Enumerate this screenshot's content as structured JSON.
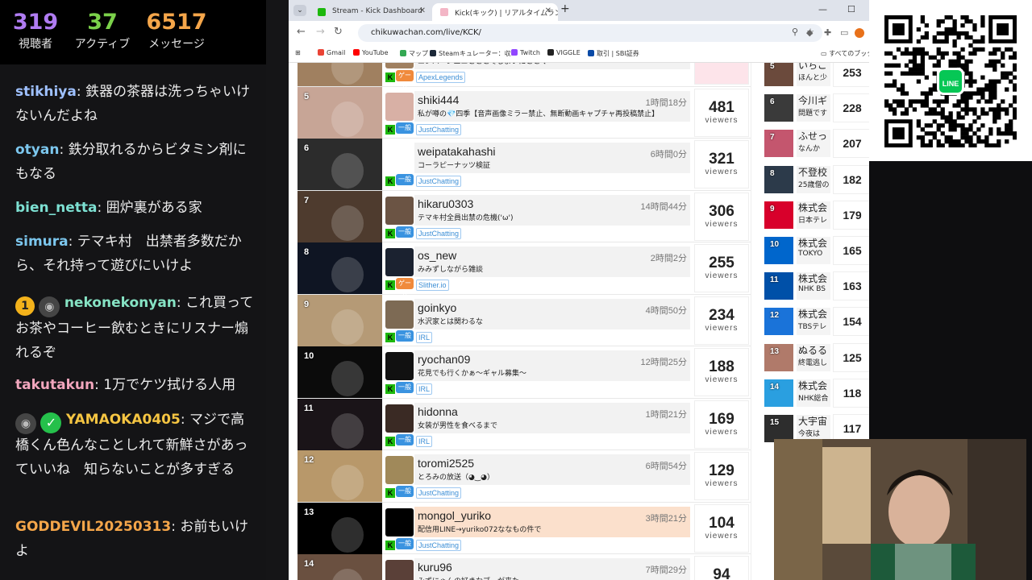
{
  "stats": [
    {
      "value": "319",
      "label": "視聴者",
      "color": "#b07cf2"
    },
    {
      "value": "37",
      "label": "アクティブ",
      "color": "#7bd14a"
    },
    {
      "value": "6517",
      "label": "メッセージ",
      "color": "#f5a64a"
    }
  ],
  "chat": [
    {
      "user": "stikhiya",
      "user_color": "#9fc1ff",
      "text": "鉄器の茶器は洗っちゃいけないんだよね",
      "badges": []
    },
    {
      "user": "otyan",
      "user_color": "#7cc7ee",
      "text": "鉄分取れるからビタミン剤にもなる",
      "badges": []
    },
    {
      "user": "bien_netta",
      "user_color": "#7de0d2",
      "text": "囲炉裏がある家",
      "badges": []
    },
    {
      "user": "simura",
      "user_color": "#7cc7ee",
      "text": "テマキ村　出禁者多数だから、それ持って遊びにいけよ",
      "badges": []
    },
    {
      "user": "nekonekonyan",
      "user_color": "#86e3c4",
      "text": "これ買ってお茶やコーヒー飲むときにリスナー煽れるぞ",
      "badges": [
        "1",
        "avatar"
      ]
    },
    {
      "user": "takutakun",
      "user_color": "#f2a6bd",
      "text": "1万でケツ拭ける人用",
      "badges": []
    },
    {
      "user": "YAMAOKA0405",
      "user_color": "#f5c542",
      "text": "マジで高橋くん色んなことしれて新鮮さがあっていいね　知らないことが多すぎる",
      "badges": [
        "avatar",
        "check"
      ]
    },
    {
      "user": "GODDEVIL20250313",
      "user_color": "#f5a64a",
      "text": "お前もいけよ",
      "badges": []
    }
  ],
  "browser": {
    "tabs": [
      {
        "label": "Stream - Kick Dashboard",
        "active": false,
        "favicon_color": "#1db80d"
      },
      {
        "label": "Kick(キック) | リアルタイムランキング",
        "active": true,
        "favicon_color": "#f3b6c6"
      }
    ],
    "url": "chikuwachan.com/live/KCK/",
    "bookmarks": [
      {
        "label": "Gmail",
        "color": "#ea4335"
      },
      {
        "label": "YouTube",
        "color": "#ff0000"
      },
      {
        "label": "マップ",
        "color": "#34a853"
      },
      {
        "label": "Steamキュレーター：収...",
        "color": "#1b2838"
      },
      {
        "label": "Twitch",
        "color": "#9146ff"
      },
      {
        "label": "VIGGLE",
        "color": "#222222"
      },
      {
        "label": "取引 | SBI証券",
        "color": "#0a4aa6"
      }
    ],
    "bookmarks_right": "すべてのブック"
  },
  "ranking": [
    {
      "rank": "",
      "name": "",
      "title": "ニンバーンエニとととてしよいにととく",
      "duration": "",
      "category": "ApexLegends",
      "tag": "ゲーム",
      "viewers": "",
      "viewers_label": "viewers",
      "highlight": false,
      "top_cut": true
    },
    {
      "rank": "5",
      "name": "shiki444",
      "title": "私が噂の💎四季【音声画像ミラー禁止、無断動画キャプチャ再投稿禁止】",
      "duration": "1時間18分",
      "category": "JustChatting",
      "tag": "一般",
      "viewers": "481",
      "viewers_label": "viewers",
      "highlight": false
    },
    {
      "rank": "6",
      "name": "weipatakahashi",
      "title": "コーラピーナッツ検証",
      "duration": "6時間0分",
      "category": "JustChatting",
      "tag": "一般",
      "viewers": "321",
      "viewers_label": "viewers",
      "highlight": false
    },
    {
      "rank": "7",
      "name": "hikaru0303",
      "title": "テマキ村全員出禁の危機('ω')",
      "duration": "14時間44分",
      "category": "JustChatting",
      "tag": "一般",
      "viewers": "306",
      "viewers_label": "viewers",
      "highlight": false
    },
    {
      "rank": "8",
      "name": "os_new",
      "title": "みみずしながら雑談",
      "duration": "2時間2分",
      "category": "Slither.io",
      "tag": "ゲーム",
      "viewers": "255",
      "viewers_label": "viewers",
      "highlight": false
    },
    {
      "rank": "9",
      "name": "goinkyo",
      "title": "水沢家とは関わるな",
      "duration": "4時間50分",
      "category": "IRL",
      "tag": "一般",
      "viewers": "234",
      "viewers_label": "viewers",
      "highlight": false
    },
    {
      "rank": "10",
      "name": "ryochan09",
      "title": "花見でも行くかぁ～ギャル募集～",
      "duration": "12時間25分",
      "category": "IRL",
      "tag": "一般",
      "viewers": "188",
      "viewers_label": "viewers",
      "highlight": false
    },
    {
      "rank": "11",
      "name": "hidonna",
      "title": "女装が男性を食べるまで",
      "duration": "1時間21分",
      "category": "IRL",
      "tag": "一般",
      "viewers": "169",
      "viewers_label": "viewers",
      "highlight": false
    },
    {
      "rank": "12",
      "name": "toromi2525",
      "title": "とろみの放送（◕‿◕）",
      "duration": "6時間54分",
      "category": "JustChatting",
      "tag": "一般",
      "viewers": "129",
      "viewers_label": "viewers",
      "highlight": false
    },
    {
      "rank": "13",
      "name": "mongol_yuriko",
      "title": "配信用LINE→yuriko072ななもの件で",
      "duration": "3時間21分",
      "category": "JustChatting",
      "tag": "一般",
      "viewers": "104",
      "viewers_label": "viewers",
      "highlight": true
    },
    {
      "rank": "14",
      "name": "kuru96",
      "title": "みずにゃんの好きなブーが来た",
      "duration": "7時間29分",
      "category": "JustChatting",
      "tag": "一般",
      "viewers": "94",
      "viewers_label": "viewers",
      "highlight": false
    }
  ],
  "side_ranking": [
    {
      "rank": "5",
      "name": "いちご",
      "sub": "ほんと少",
      "viewers": "253",
      "color": "#6b4a3c"
    },
    {
      "rank": "6",
      "name": "今川ギ",
      "sub": "問題です",
      "viewers": "228",
      "color": "#3a3a3a"
    },
    {
      "rank": "7",
      "name": "ふせっ",
      "sub": "なんか",
      "viewers": "207",
      "color": "#c4566e"
    },
    {
      "rank": "8",
      "name": "不登校",
      "sub": "25歳僧の",
      "viewers": "182",
      "color": "#2c3a4a"
    },
    {
      "rank": "9",
      "name": "株式会",
      "sub": "日本テレ",
      "viewers": "179",
      "color": "#d8002b"
    },
    {
      "rank": "10",
      "name": "株式会",
      "sub": "TOKYO",
      "viewers": "165",
      "color": "#0066cc"
    },
    {
      "rank": "11",
      "name": "株式会",
      "sub": "NHK BS",
      "viewers": "163",
      "color": "#0050a8"
    },
    {
      "rank": "12",
      "name": "株式会",
      "sub": "TBSテレ",
      "viewers": "154",
      "color": "#1a73d9"
    },
    {
      "rank": "13",
      "name": "ぬるる",
      "sub": "終電逃し",
      "viewers": "125",
      "color": "#b07a6a"
    },
    {
      "rank": "14",
      "name": "株式会",
      "sub": "NHK総合",
      "viewers": "118",
      "color": "#2a9fe0"
    },
    {
      "rank": "15",
      "name": "大宇宙",
      "sub": "今夜は",
      "viewers": "117",
      "color": "#2d2d2d"
    }
  ],
  "qr": {
    "center_label": "LINE",
    "center_color": "#06c755"
  },
  "thumb_colors": [
    "#a08060",
    "#c7a596",
    "#2c2c2c",
    "#4e3b2e",
    "#0f1523",
    "#b59a76",
    "#0b0b0b",
    "#1a1418",
    "#b8986a",
    "#000000",
    "#6a5040"
  ],
  "avatar_colors": [
    "#a08060",
    "#d8b0a5",
    "#ffffff",
    "#6b5444",
    "#1b2230",
    "#7d6a54",
    "#111111",
    "#3a2a24",
    "#a0895a",
    "#000000",
    "#5a4038"
  ]
}
